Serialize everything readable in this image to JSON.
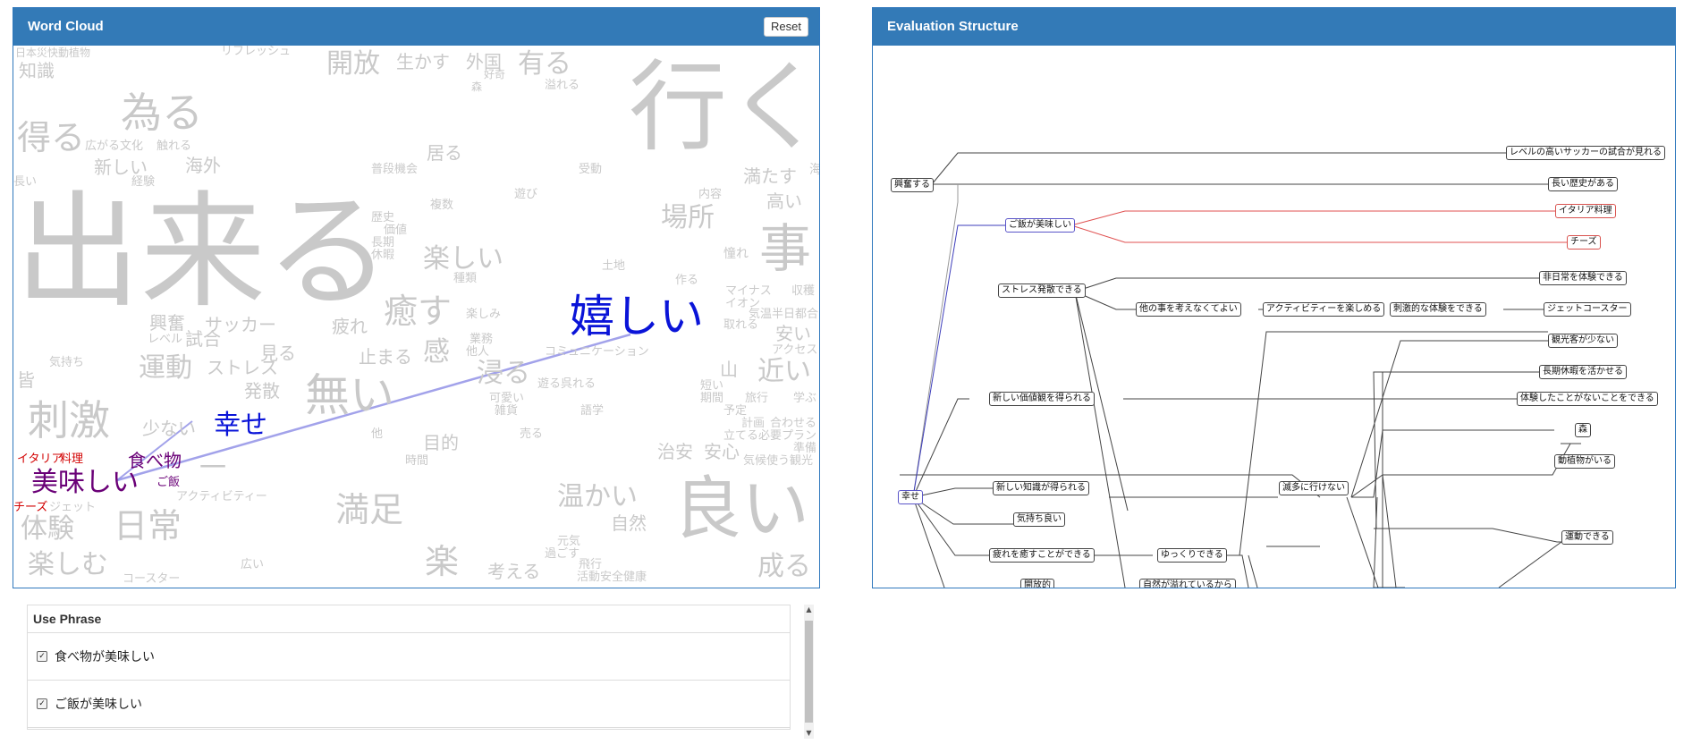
{
  "word_cloud": {
    "title": "Word Cloud",
    "reset_label": "Reset",
    "words": [
      {
        "text": "日本災快動植物",
        "color": "#c9c9c9"
      },
      {
        "text": "リフレッシュ",
        "color": "#c9c9c9"
      },
      {
        "text": "開放",
        "color": "#c9c9c9"
      },
      {
        "text": "生かす",
        "color": "#c9c9c9"
      },
      {
        "text": "外国",
        "color": "#c9c9c9"
      },
      {
        "text": "有る",
        "color": "#c9c9c9"
      },
      {
        "text": "行く",
        "color": "#c9c9c9"
      },
      {
        "text": "知識",
        "color": "#c9c9c9"
      },
      {
        "text": "好奇",
        "color": "#c9c9c9"
      },
      {
        "text": "森",
        "color": "#c9c9c9"
      },
      {
        "text": "溢れる",
        "color": "#c9c9c9"
      },
      {
        "text": "為る",
        "color": "#c9c9c9"
      },
      {
        "text": "得る",
        "color": "#c9c9c9"
      },
      {
        "text": "広がる文化",
        "color": "#c9c9c9"
      },
      {
        "text": "触れる",
        "color": "#c9c9c9"
      },
      {
        "text": "居る",
        "color": "#c9c9c9"
      },
      {
        "text": "新しい",
        "color": "#c9c9c9"
      },
      {
        "text": "海外",
        "color": "#c9c9c9"
      },
      {
        "text": "普段機会",
        "color": "#c9c9c9"
      },
      {
        "text": "受動",
        "color": "#c9c9c9"
      },
      {
        "text": "満たす",
        "color": "#c9c9c9"
      },
      {
        "text": "海",
        "color": "#c9c9c9"
      },
      {
        "text": "長い",
        "color": "#c9c9c9"
      },
      {
        "text": "経験",
        "color": "#c9c9c9"
      },
      {
        "text": "遊び",
        "color": "#c9c9c9"
      },
      {
        "text": "内容",
        "color": "#c9c9c9"
      },
      {
        "text": "高い",
        "color": "#c9c9c9"
      },
      {
        "text": "出来る",
        "color": "#c9c9c9"
      },
      {
        "text": "複数",
        "color": "#c9c9c9"
      },
      {
        "text": "場所",
        "color": "#c9c9c9"
      },
      {
        "text": "歴史",
        "color": "#c9c9c9"
      },
      {
        "text": "価値",
        "color": "#c9c9c9"
      },
      {
        "text": "長期",
        "color": "#c9c9c9"
      },
      {
        "text": "休暇",
        "color": "#c9c9c9"
      },
      {
        "text": "楽しい",
        "color": "#c9c9c9"
      },
      {
        "text": "憧れ",
        "color": "#c9c9c9"
      },
      {
        "text": "事",
        "color": "#c9c9c9"
      },
      {
        "text": "土地",
        "color": "#c9c9c9"
      },
      {
        "text": "種類",
        "color": "#c9c9c9"
      },
      {
        "text": "作る",
        "color": "#c9c9c9"
      },
      {
        "text": "マイナス",
        "color": "#c9c9c9"
      },
      {
        "text": "収穫",
        "color": "#c9c9c9"
      },
      {
        "text": "イオン",
        "color": "#c9c9c9"
      },
      {
        "text": "気温半日都合",
        "color": "#c9c9c9"
      },
      {
        "text": "嬉しい",
        "color": "#0a14d8"
      },
      {
        "text": "癒す",
        "color": "#c9c9c9"
      },
      {
        "text": "楽しみ",
        "color": "#c9c9c9"
      },
      {
        "text": "興奮",
        "color": "#c9c9c9"
      },
      {
        "text": "サッカー",
        "color": "#c9c9c9"
      },
      {
        "text": "疲れ",
        "color": "#c9c9c9"
      },
      {
        "text": "取れる",
        "color": "#c9c9c9"
      },
      {
        "text": "安い",
        "color": "#c9c9c9"
      },
      {
        "text": "レベル",
        "color": "#c9c9c9"
      },
      {
        "text": "試合",
        "color": "#c9c9c9"
      },
      {
        "text": "業務",
        "color": "#c9c9c9"
      },
      {
        "text": "見る",
        "color": "#c9c9c9"
      },
      {
        "text": "他人",
        "color": "#c9c9c9"
      },
      {
        "text": "感",
        "color": "#c9c9c9"
      },
      {
        "text": "止まる",
        "color": "#c9c9c9"
      },
      {
        "text": "コミュニケーション",
        "color": "#c9c9c9"
      },
      {
        "text": "アクセス",
        "color": "#c9c9c9"
      },
      {
        "text": "気持ち",
        "color": "#c9c9c9"
      },
      {
        "text": "運動",
        "color": "#c9c9c9"
      },
      {
        "text": "ストレス",
        "color": "#c9c9c9"
      },
      {
        "text": "山",
        "color": "#c9c9c9"
      },
      {
        "text": "近い",
        "color": "#c9c9c9"
      },
      {
        "text": "浸る",
        "color": "#c9c9c9"
      },
      {
        "text": "皆",
        "color": "#c9c9c9"
      },
      {
        "text": "発散",
        "color": "#c9c9c9"
      },
      {
        "text": "無い",
        "color": "#c9c9c9"
      },
      {
        "text": "遊る呉れる",
        "color": "#c9c9c9"
      },
      {
        "text": "短い",
        "color": "#c9c9c9"
      },
      {
        "text": "期間",
        "color": "#c9c9c9"
      },
      {
        "text": "旅行",
        "color": "#c9c9c9"
      },
      {
        "text": "学ぶ",
        "color": "#c9c9c9"
      },
      {
        "text": "可愛い",
        "color": "#c9c9c9"
      },
      {
        "text": "雑貨",
        "color": "#c9c9c9"
      },
      {
        "text": "刺激",
        "color": "#c9c9c9"
      },
      {
        "text": "語学",
        "color": "#c9c9c9"
      },
      {
        "text": "予定",
        "color": "#c9c9c9"
      },
      {
        "text": "計画",
        "color": "#c9c9c9"
      },
      {
        "text": "合わせる",
        "color": "#c9c9c9"
      },
      {
        "text": "少ない",
        "color": "#c9c9c9"
      },
      {
        "text": "幸せ",
        "color": "#0a14d8"
      },
      {
        "text": "他",
        "color": "#c9c9c9"
      },
      {
        "text": "目的",
        "color": "#c9c9c9"
      },
      {
        "text": "売る",
        "color": "#c9c9c9"
      },
      {
        "text": "立てる必要プラン",
        "color": "#c9c9c9"
      },
      {
        "text": "準備",
        "color": "#c9c9c9"
      },
      {
        "text": "イタリア",
        "color": "#d20000"
      },
      {
        "text": "料理",
        "color": "#d20000"
      },
      {
        "text": "食べ物",
        "color": "#6a0077"
      },
      {
        "text": "時間",
        "color": "#c9c9c9"
      },
      {
        "text": "治安",
        "color": "#c9c9c9"
      },
      {
        "text": "安心",
        "color": "#c9c9c9"
      },
      {
        "text": "気候使う観光",
        "color": "#c9c9c9"
      },
      {
        "text": "美味しい",
        "color": "#6a0077"
      },
      {
        "text": "ご飯",
        "color": "#6a0077"
      },
      {
        "text": "一",
        "color": "#c9c9c9"
      },
      {
        "text": "アクティビティー",
        "color": "#c9c9c9"
      },
      {
        "text": "温かい",
        "color": "#c9c9c9"
      },
      {
        "text": "チーズ",
        "color": "#d20000"
      },
      {
        "text": "ジェット",
        "color": "#c9c9c9"
      },
      {
        "text": "満足",
        "color": "#c9c9c9"
      },
      {
        "text": "良い",
        "color": "#c9c9c9"
      },
      {
        "text": "自然",
        "color": "#c9c9c9"
      },
      {
        "text": "体験",
        "color": "#c9c9c9"
      },
      {
        "text": "日常",
        "color": "#c9c9c9"
      },
      {
        "text": "元気",
        "color": "#c9c9c9"
      },
      {
        "text": "過ごす",
        "color": "#c9c9c9"
      },
      {
        "text": "飛行",
        "color": "#c9c9c9"
      },
      {
        "text": "楽しむ",
        "color": "#c9c9c9"
      },
      {
        "text": "広い",
        "color": "#c9c9c9"
      },
      {
        "text": "楽",
        "color": "#c9c9c9"
      },
      {
        "text": "考える",
        "color": "#c9c9c9"
      },
      {
        "text": "活動安全健康",
        "color": "#c9c9c9"
      },
      {
        "text": "成る",
        "color": "#c9c9c9"
      },
      {
        "text": "コースター",
        "color": "#c9c9c9"
      }
    ]
  },
  "evaluation_structure": {
    "title": "Evaluation Structure",
    "nodes": [
      "興奮する",
      "レベルの高いサッカーの試合が見れる",
      "長い歴史がある",
      "ご飯が美味しい",
      "イタリア料理",
      "チーズ",
      "ストレス発散できる",
      "非日常を体験できる",
      "他の事を考えなくてよい",
      "アクティビティーを楽しめる",
      "刺激的な体験をできる",
      "ジェットコースター",
      "観光客が少ない",
      "長期休暇を活かせる",
      "新しい価値観を得られる",
      "体験したことがないことをできる",
      "森",
      "動植物がいる",
      "幸せ",
      "新しい知識が得られる",
      "滅多に行けない",
      "気持ち良い",
      "運動できる",
      "疲れを癒すことができる",
      "ゆっくりできる",
      "開放的",
      "自然が溢れているから"
    ]
  },
  "use_phrase": {
    "title": "Use Phrase",
    "items": [
      {
        "label": "食べ物が美味しい",
        "checked": true,
        "mark": "✓"
      },
      {
        "label": "ご飯が美味しい",
        "checked": true,
        "mark": "✓"
      }
    ]
  },
  "scrollbar": {
    "up": "▲",
    "down": "▼"
  },
  "colors": {
    "header": "#337ab7",
    "cloud_gray": "#c9c9c9",
    "highlight_blue": "#0a14d8",
    "highlight_purple": "#6a0077",
    "highlight_red": "#d20000",
    "edge_dark": "#444444",
    "edge_red": "#e05050",
    "edge_blue": "#3d3dbb"
  }
}
